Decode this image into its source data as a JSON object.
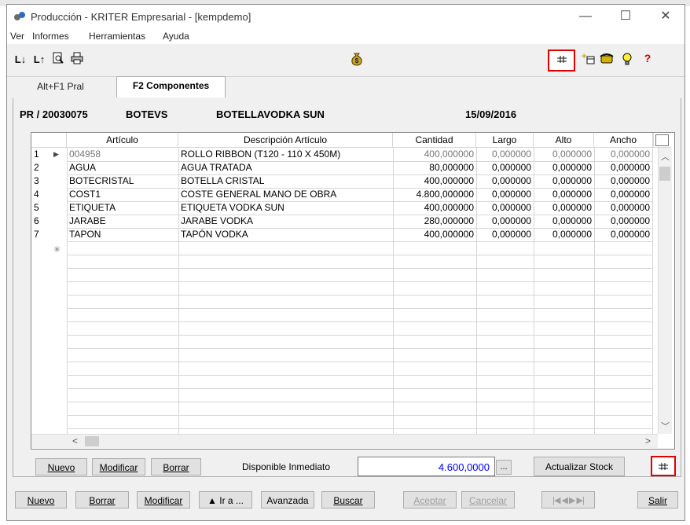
{
  "window": {
    "title": "Producción - KRITER Empresarial  - [kempdemo]",
    "controls": {
      "minimize": "—",
      "maximize": "☐",
      "close": "✕"
    }
  },
  "menu": [
    "Ver",
    "Informes",
    "Herramientas",
    "Ayuda"
  ],
  "toolbar": {
    "left_icons": [
      "sort-ascending-icon",
      "sort-descending-icon",
      "print-preview-icon",
      "printer-icon"
    ],
    "center_icon": "money-bag-icon",
    "right_icons": [
      "grid-columns-icon",
      "add-new-icon",
      "phone-icon",
      "lightbulb-icon",
      "help-icon"
    ]
  },
  "tabs": [
    {
      "label": "Alt+F1 Pral",
      "active": false
    },
    {
      "label": "F2 Componentes",
      "active": true
    }
  ],
  "header": {
    "code": "PR / 20030075",
    "article": "BOTEVS",
    "description": "BOTELLAVODKA SUN",
    "date": "15/09/2016"
  },
  "grid": {
    "columns": [
      "",
      "Artículo",
      "Descripción Artículo",
      "Cantidad",
      "Largo",
      "Alto",
      "Ancho"
    ],
    "rows": [
      {
        "n": "1",
        "articulo": "004958",
        "descripcion": "ROLLO RIBBON (T120 - 110 X 450M)",
        "cantidad": "400,000000",
        "largo": "0,000000",
        "alto": "0,000000",
        "ancho": "0,000000",
        "current": true
      },
      {
        "n": "2",
        "articulo": "AGUA",
        "descripcion": "AGUA TRATADA",
        "cantidad": "80,000000",
        "largo": "0,000000",
        "alto": "0,000000",
        "ancho": "0,000000"
      },
      {
        "n": "3",
        "articulo": "BOTECRISTAL",
        "descripcion": "BOTELLA CRISTAL",
        "cantidad": "400,000000",
        "largo": "0,000000",
        "alto": "0,000000",
        "ancho": "0,000000"
      },
      {
        "n": "4",
        "articulo": "COST1",
        "descripcion": "COSTE GENERAL MANO DE OBRA",
        "cantidad": "4.800,000000",
        "largo": "0,000000",
        "alto": "0,000000",
        "ancho": "0,000000"
      },
      {
        "n": "5",
        "articulo": "ETIQUETA",
        "descripcion": "ETIQUETA VODKA SUN",
        "cantidad": "400,000000",
        "largo": "0,000000",
        "alto": "0,000000",
        "ancho": "0,000000"
      },
      {
        "n": "6",
        "articulo": "JARABE",
        "descripcion": "JARABE VODKA",
        "cantidad": "280,000000",
        "largo": "0,000000",
        "alto": "0,000000",
        "ancho": "0,000000"
      },
      {
        "n": "7",
        "articulo": "TAPON",
        "descripcion": "TAPÓN VODKA",
        "cantidad": "400,000000",
        "largo": "0,000000",
        "alto": "0,000000",
        "ancho": "0,000000"
      }
    ],
    "new_row_marker": "✳"
  },
  "panel_buttons": {
    "nuevo": "Nuevo",
    "modificar": "Modificar",
    "borrar": "Borrar",
    "disponible_label": "Disponible Inmediato",
    "disponible_value": "4.600,0000",
    "ellipsis": "...",
    "actualizar": "Actualizar Stock"
  },
  "bottom_buttons": {
    "nuevo": "Nuevo",
    "borrar": "Borrar",
    "modificar": "Modificar",
    "ira": "▲ Ir a ...",
    "avanzada": "Avanzada",
    "buscar": "Buscar",
    "aceptar": "Aceptar",
    "cancelar": "Cancelar",
    "nav": "|◀ ◀ ▶ ▶|",
    "salir": "Salir"
  },
  "colors": {
    "highlight": "#e00000",
    "value_blue": "#0000ff",
    "disabled": "#a0a0a0"
  }
}
